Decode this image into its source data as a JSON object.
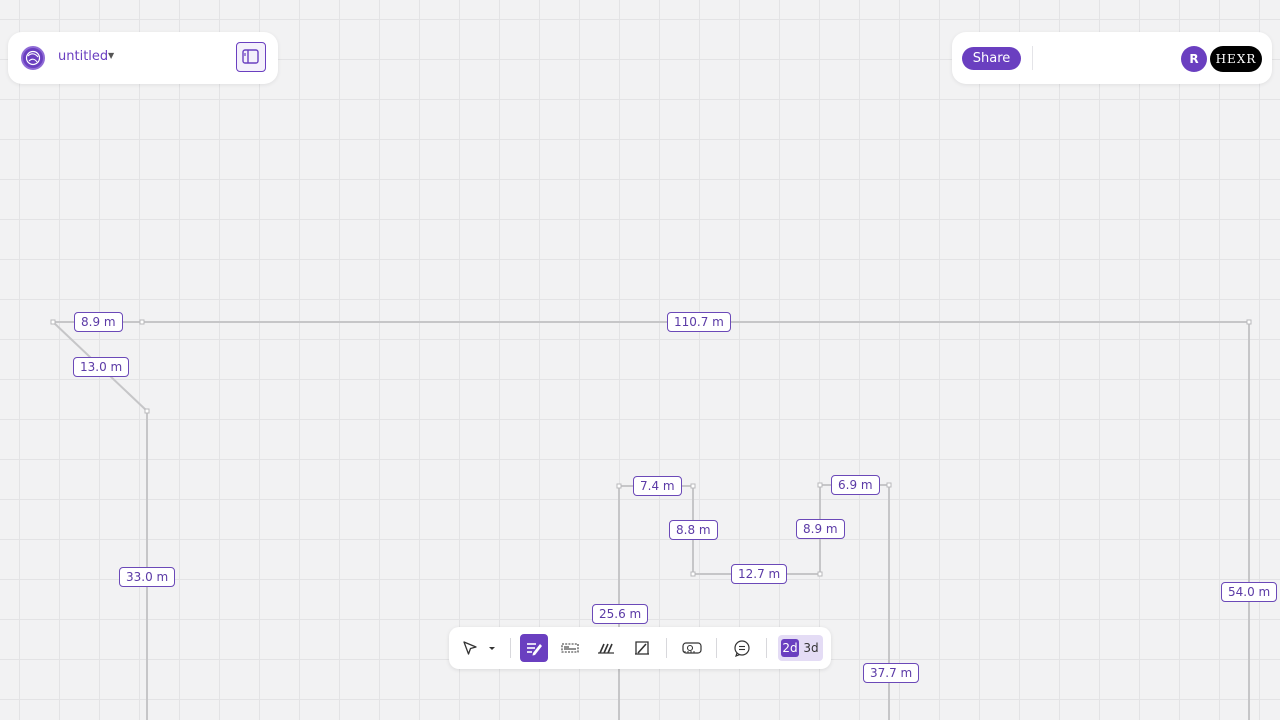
{
  "header": {
    "project_title": "untitled",
    "share_label": "Share",
    "user_initial": "R",
    "brand": "HEXR"
  },
  "canvas": {
    "dimensions": [
      "8.9 m",
      "110.7 m",
      "13.0 m",
      "33.0 m",
      "7.4 m",
      "6.9 m",
      "8.8 m",
      "8.9 m",
      "12.7 m",
      "25.6 m",
      "54.0 m",
      "37.7 m"
    ]
  },
  "toolbar": {
    "tools": [
      "pointer-tool",
      "wall-tool",
      "window-tool",
      "stairs-tool",
      "door-tool",
      "measure-tool",
      "comment-tool"
    ],
    "active_tool": "wall-tool",
    "mode_2d": "2d",
    "mode_3d": "3d",
    "active_mode": "2d"
  },
  "colors": {
    "accent": "#6a3fc0",
    "wall": "#c6c6c8",
    "grid": "#e3e3e5"
  }
}
